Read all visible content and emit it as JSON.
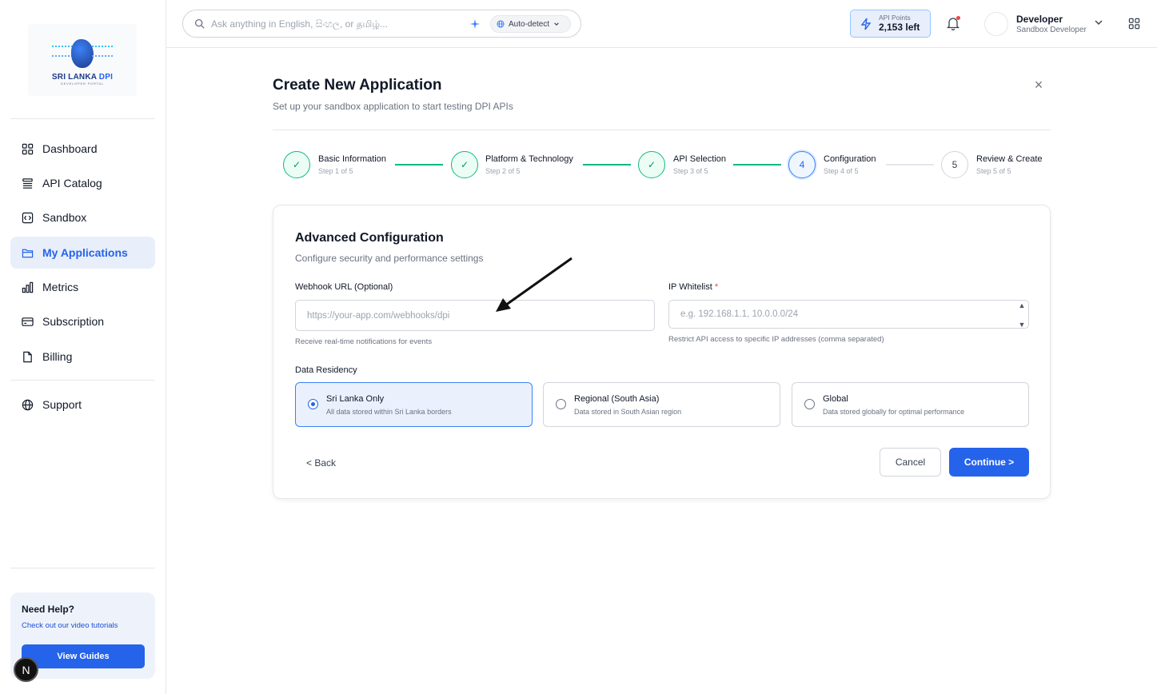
{
  "brand": {
    "logo_text_1": "SRI LANKA",
    "logo_text_2": "DPI",
    "logo_sub": "DEVELOPER PORTAL"
  },
  "sidebar": {
    "items": [
      {
        "label": "Dashboard",
        "icon": "dashboard-grid-icon"
      },
      {
        "label": "API Catalog",
        "icon": "list-icon"
      },
      {
        "label": "Sandbox",
        "icon": "code-box-icon"
      },
      {
        "label": "My Applications",
        "icon": "folder-icon",
        "active": true
      },
      {
        "label": "Metrics",
        "icon": "bar-chart-icon"
      },
      {
        "label": "Subscription",
        "icon": "credit-card-icon"
      },
      {
        "label": "Billing",
        "icon": "document-icon"
      },
      {
        "label": "Support",
        "icon": "globe-icon"
      }
    ],
    "help": {
      "title": "Need Help?",
      "subtitle": "Check out our video tutorials",
      "button": "View Guides"
    },
    "badge": "N"
  },
  "topbar": {
    "search_placeholder": "Ask anything in English, සිංහල, or தமிழ்...",
    "language": "Auto-detect",
    "api_points_label": "API Points",
    "api_points_value": "2,153 left",
    "user_name": "Developer",
    "user_role": "Sandbox Developer"
  },
  "page": {
    "title": "Create New Application",
    "subtitle": "Set up your sandbox application to start testing DPI APIs",
    "close": "×"
  },
  "steps": [
    {
      "name": "Basic Information",
      "sub": "Step 1 of 5",
      "state": "done",
      "marker": "✓"
    },
    {
      "name": "Platform & Technology",
      "sub": "Step 2 of 5",
      "state": "done",
      "marker": "✓"
    },
    {
      "name": "API Selection",
      "sub": "Step 3 of 5",
      "state": "done",
      "marker": "✓"
    },
    {
      "name": "Configuration",
      "sub": "Step 4 of 5",
      "state": "current",
      "marker": "4"
    },
    {
      "name": "Review & Create",
      "sub": "Step 5 of 5",
      "state": "todo",
      "marker": "5"
    }
  ],
  "form": {
    "title": "Advanced Configuration",
    "subtitle": "Configure security and performance settings",
    "webhook_label": "Webhook URL (Optional)",
    "webhook_placeholder": "https://your-app.com/webhooks/dpi",
    "webhook_value": "",
    "webhook_hint": "Receive real-time notifications for events",
    "ip_label": "IP Whitelist",
    "ip_required_mark": "*",
    "ip_placeholder": "e.g. 192.168.1.1, 10.0.0.0/24",
    "ip_value": "",
    "ip_hint": "Restrict API access to specific IP addresses (comma separated)",
    "residency_label": "Data Residency",
    "residency_options": [
      {
        "title": "Sri Lanka Only",
        "sub": "All data stored within Sri Lanka borders",
        "selected": true
      },
      {
        "title": "Regional (South Asia)",
        "sub": "Data stored in South Asian region",
        "selected": false
      },
      {
        "title": "Global",
        "sub": "Data stored globally for optimal performance",
        "selected": false
      }
    ],
    "back": "< Back",
    "cancel": "Cancel",
    "continue": "Continue >"
  },
  "colors": {
    "accent": "#2563eb",
    "success": "#10b981",
    "active_bg": "#e8effb"
  }
}
